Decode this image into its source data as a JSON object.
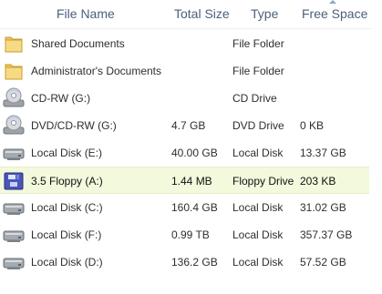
{
  "header": {
    "file_name": "File Name",
    "total_size": "Total Size",
    "type": "Type",
    "free_space": "Free Space"
  },
  "rows": [
    {
      "name": "Shared Documents",
      "total_size": "",
      "type": "File Folder",
      "free_space": "",
      "icon": "folder-icon",
      "selected": false
    },
    {
      "name": "Administrator's Documents",
      "total_size": "",
      "type": "File Folder",
      "free_space": "",
      "icon": "folder-icon",
      "selected": false
    },
    {
      "name": "CD-RW (G:)",
      "total_size": "",
      "type": "CD Drive",
      "free_space": "",
      "icon": "optical-drive-icon",
      "selected": false
    },
    {
      "name": "DVD/CD-RW (G:)",
      "total_size": "4.7 GB",
      "type": "DVD Drive",
      "free_space": "0 KB",
      "icon": "optical-drive-icon",
      "selected": false
    },
    {
      "name": "Local Disk (E:)",
      "total_size": "40.00 GB",
      "type": "Local Disk",
      "free_space": "13.37 GB",
      "icon": "hard-disk-icon",
      "selected": false
    },
    {
      "name": "3.5 Floppy (A:)",
      "total_size": "1.44 MB",
      "type": "Floppy Drive",
      "free_space": "203 KB",
      "icon": "floppy-disk-icon",
      "selected": true
    },
    {
      "name": "Local Disk (C:)",
      "total_size": "160.4 GB",
      "type": "Local Disk",
      "free_space": "31.02 GB",
      "icon": "hard-disk-icon",
      "selected": false
    },
    {
      "name": "Local Disk (F:)",
      "total_size": "0.99 TB",
      "type": "Local Disk",
      "free_space": "357.37 GB",
      "icon": "hard-disk-icon",
      "selected": false
    },
    {
      "name": "Local Disk (D:)",
      "total_size": "136.2 GB",
      "type": "Local Disk",
      "free_space": "57.52 GB",
      "icon": "hard-disk-icon",
      "selected": false
    }
  ],
  "colors": {
    "header_text": "#4c607a",
    "selected_row_bg": "#f3f9dd",
    "selected_row_border": "#e7efc2",
    "folder_yellow": "#f1c75a",
    "drive_gray": "#9ea3a8",
    "floppy_blue": "#4a56b8"
  }
}
